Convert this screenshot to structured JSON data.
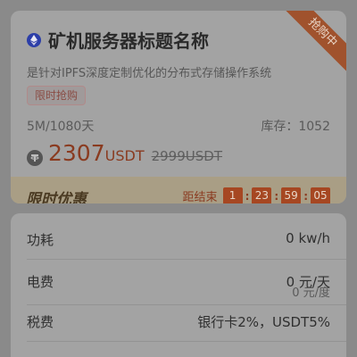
{
  "product": {
    "title": "矿机服务器标题名称",
    "subtitle": "是针对IPFS深度定制优化的分布式存储操作系统",
    "tag": "限时抢购",
    "ribbon": "抢购中",
    "spec": "5M/1080天",
    "stock": "库存：1052",
    "price": "2307",
    "price_unit": "USDT",
    "original_price": "2999USDT"
  },
  "promo": {
    "title": "限时优惠",
    "countdown_label": "距结束",
    "hours": "1",
    "minutes": "23",
    "seconds": "59",
    "millis": "05"
  },
  "details": {
    "power_label": "功耗",
    "power_value": "0 kw/h",
    "electricity_label": "电费",
    "electricity_value": "0 元/天",
    "electricity_sub": "0 元/度",
    "tax_label": "税费",
    "tax_value": "银行卡2%，USDT5%"
  },
  "colors": {
    "accent": "#a64722",
    "price": "#8a3b20"
  },
  "icons": {
    "title_icon": "ethereum-icon",
    "price_icon": "tether-icon"
  }
}
